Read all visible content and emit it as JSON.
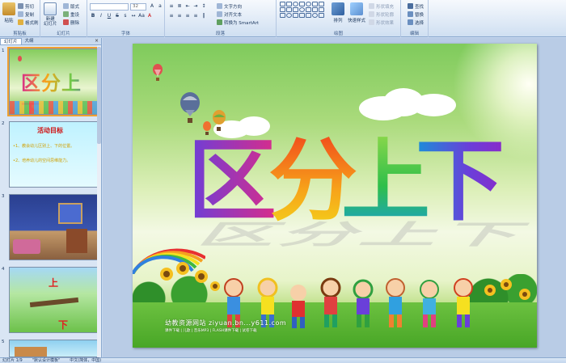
{
  "ribbon": {
    "clipboard": {
      "label": "剪贴板",
      "paste": "粘贴",
      "cut": "剪切",
      "copy": "复制",
      "format_painter": "格式刷"
    },
    "slides": {
      "label": "幻灯片",
      "new_slide": "新建\n幻灯片",
      "layout": "版式",
      "reset": "重设",
      "delete": "删除"
    },
    "font": {
      "label": "字体",
      "font_name": "",
      "font_size": "32"
    },
    "paragraph": {
      "label": "段落",
      "text_direction": "文字方向",
      "align_text": "对齐文本",
      "smartart": "转换为 SmartArt"
    },
    "drawing": {
      "label": "绘图",
      "arrange": "排列",
      "quick_styles": "快速样式",
      "shape_fill": "形状填充",
      "shape_outline": "形状轮廓",
      "shape_effects": "形状效果"
    },
    "editing": {
      "label": "编辑",
      "find": "查找",
      "replace": "替换",
      "select": "选择"
    }
  },
  "left_panel": {
    "tabs": [
      "幻灯片",
      "大纲"
    ],
    "close": "×",
    "thumbnails": [
      {
        "num": "1",
        "title": "区分上下"
      },
      {
        "num": "2",
        "title": "活动目标",
        "lines": [
          "•1、教会幼儿区别上、下的位置。",
          "•2、培养幼儿的空间思维能力。"
        ]
      },
      {
        "num": "3"
      },
      {
        "num": "4",
        "top": "上",
        "bottom": "下"
      },
      {
        "num": "5"
      }
    ]
  },
  "slide": {
    "title_chars": [
      "区",
      "分",
      "上",
      "下"
    ],
    "watermark": "幼教资源网站  ziyuan.bn...y611.com",
    "watermark_sub": "课件下载 | 儿歌 | 音乐MP3 | FLASH课件下载 | 试卷下载"
  },
  "status": {
    "slide_info": "幻灯片 1/9",
    "theme": "\"默认设计模板\"",
    "language": "中文(简体，中国)"
  },
  "colors": {
    "ribbon_bg": "#dbe7f5",
    "panel_bg": "#d9e5f4",
    "selection": "#f0a030",
    "char1": "#d92c8a",
    "char2": "#f7a41a",
    "char3": "#6cc94a",
    "char4": "#6a3fd9"
  }
}
